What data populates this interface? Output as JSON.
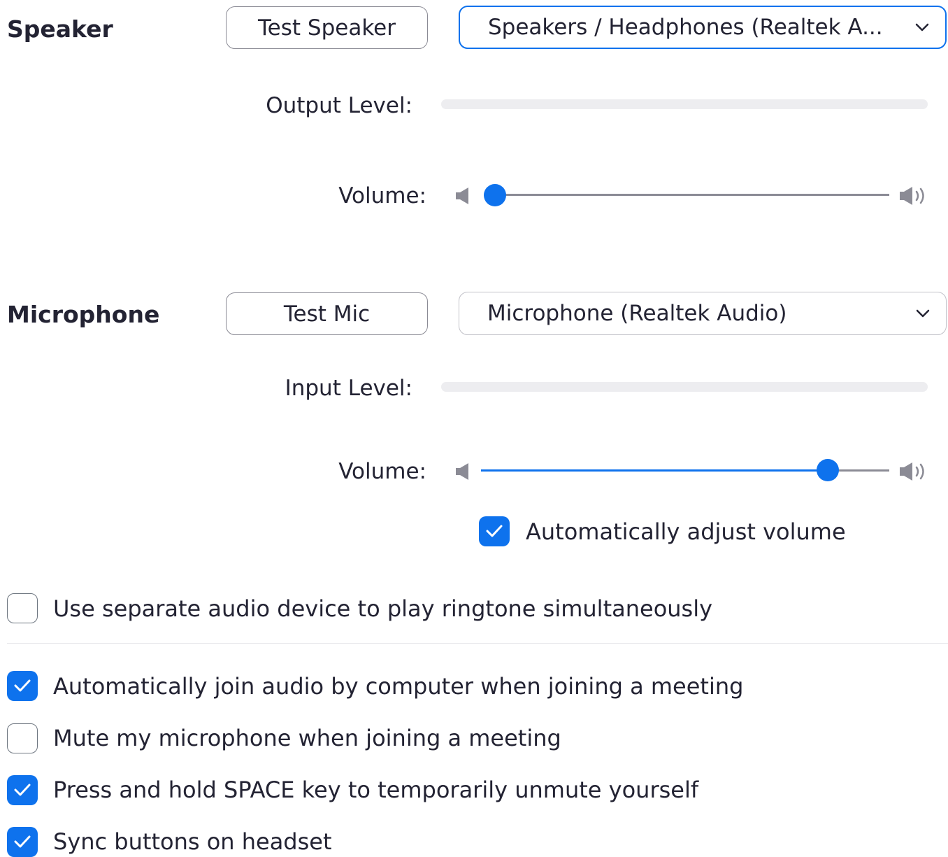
{
  "speaker": {
    "title": "Speaker",
    "test_button": "Test Speaker",
    "device": "Speakers / Headphones (Realtek A...",
    "output_level_label": "Output Level:",
    "output_level": 0,
    "volume_label": "Volume:",
    "volume": 0
  },
  "microphone": {
    "title": "Microphone",
    "test_button": "Test Mic",
    "device": "Microphone (Realtek Audio)",
    "input_level_label": "Input Level:",
    "input_level": 0,
    "volume_label": "Volume:",
    "volume": 0.85,
    "auto_adjust": {
      "label": "Automatically adjust volume",
      "checked": true
    }
  },
  "options": [
    {
      "label": "Use separate audio device to play ringtone simultaneously",
      "checked": false
    },
    {
      "label": "Automatically join audio by computer when joining a meeting",
      "checked": true
    },
    {
      "label": "Mute my microphone when joining a meeting",
      "checked": false
    },
    {
      "label": "Press and hold SPACE key to temporarily unmute yourself",
      "checked": true
    },
    {
      "label": "Sync buttons on headset",
      "checked": true
    }
  ],
  "colors": {
    "accent": "#0e72ed",
    "text": "#232333",
    "level_bar": "#ededf0"
  },
  "icons": {
    "speaker_low": "volume-low-icon",
    "speaker_high": "volume-high-icon",
    "dropdown": "chevron-down-icon",
    "check": "checkmark-icon"
  }
}
